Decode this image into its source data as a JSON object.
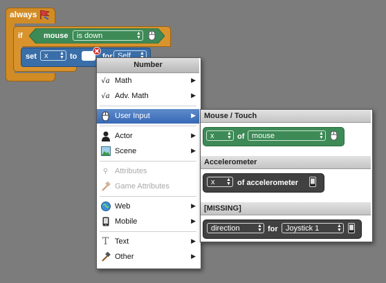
{
  "blocks": {
    "always_label": "always",
    "if_label": "if",
    "condition": {
      "label": "mouse",
      "dropdown": "is down",
      "icon": "mouse-icon"
    },
    "set": {
      "label": "set",
      "var": "x",
      "to_label": "to",
      "for_label": "for",
      "target": "Self"
    }
  },
  "menu": {
    "title": "Number",
    "items": [
      {
        "label": "Math",
        "icon": "sqrt-icon",
        "submenu": true,
        "enabled": true
      },
      {
        "label": "Adv. Math",
        "icon": "sqrt-icon",
        "submenu": true,
        "enabled": true
      },
      {
        "label": "User Input",
        "icon": "mouse-icon",
        "submenu": true,
        "enabled": true,
        "selected": true
      },
      {
        "label": "Actor",
        "icon": "actor-icon",
        "submenu": true,
        "enabled": true
      },
      {
        "label": "Scene",
        "icon": "scene-icon",
        "submenu": true,
        "enabled": true
      },
      {
        "label": "Attributes",
        "icon": "attributes-icon",
        "submenu": false,
        "enabled": false
      },
      {
        "label": "Game Attributes",
        "icon": "hammer-icon",
        "submenu": false,
        "enabled": false
      },
      {
        "label": "Web",
        "icon": "globe-icon",
        "submenu": true,
        "enabled": true
      },
      {
        "label": "Mobile",
        "icon": "phone-icon",
        "submenu": true,
        "enabled": true
      },
      {
        "label": "Text",
        "icon": "text-icon",
        "submenu": true,
        "enabled": true
      },
      {
        "label": "Other",
        "icon": "hammer-icon",
        "submenu": true,
        "enabled": true
      }
    ]
  },
  "submenu": {
    "sections": [
      {
        "title": "Mouse / Touch",
        "block": {
          "dropdown1": "x",
          "of_label": "of",
          "dropdown2": "mouse",
          "icon": "mouse-icon"
        }
      },
      {
        "title": "Accelerometer",
        "block": {
          "dropdown1": "x",
          "of_label": "of accelerometer",
          "icon": "phone-icon"
        }
      },
      {
        "title": "[MISSING]",
        "block": {
          "dropdown1": "direction",
          "for_label": "for",
          "dropdown2": "Joystick 1",
          "icon": "phone-icon"
        }
      }
    ]
  },
  "colors": {
    "background": "#7c7c7c",
    "event_block": "#d28c25",
    "condition_block": "#3d8a56",
    "action_block": "#3a6ea8",
    "menu_selected": "#3768b5",
    "dark_block": "#414141"
  }
}
